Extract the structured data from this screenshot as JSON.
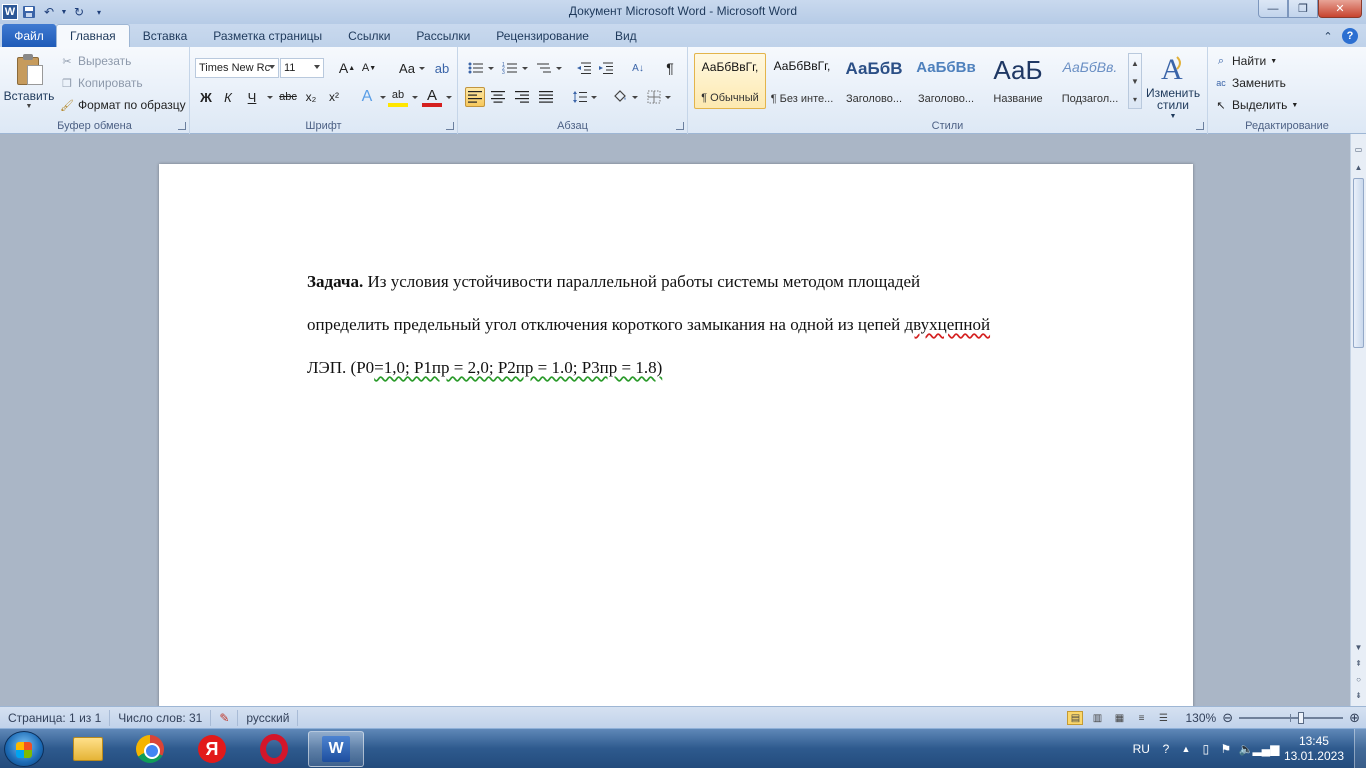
{
  "window": {
    "title": "Документ Microsoft Word  -  Microsoft Word",
    "minimize": "—",
    "maximize": "❐",
    "close": "✕"
  },
  "tabs": {
    "file": "Файл",
    "items": [
      "Главная",
      "Вставка",
      "Разметка страницы",
      "Ссылки",
      "Рассылки",
      "Рецензирование",
      "Вид"
    ]
  },
  "clipboard": {
    "paste": "Вставить",
    "cut": "Вырезать",
    "copy": "Копировать",
    "format_painter": "Формат по образцу",
    "label": "Буфер обмена"
  },
  "font": {
    "name": "Times New Rc",
    "size": "11",
    "label": "Шрифт",
    "grow": "A",
    "shrink": "A",
    "case": "Aa",
    "bold": "Ж",
    "italic": "К",
    "underline": "Ч",
    "strike": "abc",
    "subscript": "x₂",
    "superscript": "x²",
    "effects": "A",
    "highlight": "ab",
    "color": "A"
  },
  "paragraph": {
    "label": "Абзац",
    "show_marks": "¶"
  },
  "styles": {
    "label": "Стили",
    "items": [
      {
        "sample": "АаБбВвГг,",
        "name": "¶ Обычный"
      },
      {
        "sample": "АаБбВвГг,",
        "name": "¶ Без инте..."
      },
      {
        "sample": "АаБбВ",
        "name": "Заголово..."
      },
      {
        "sample": "АаБбВв",
        "name": "Заголово..."
      },
      {
        "sample": "АаБ",
        "name": "Название"
      },
      {
        "sample": "АаБбВв.",
        "name": "Подзагол..."
      }
    ],
    "change_line1": "Изменить",
    "change_line2": "стили"
  },
  "editing": {
    "label": "Редактирование",
    "find": "Найти",
    "replace": "Заменить",
    "select": "Выделить"
  },
  "document": {
    "bold_lead": "Задача.",
    "line1": " Из условия устойчивости параллельной работы системы методом площадей",
    "line2_start": "определить предельный угол отключения короткого замыкания на одной из цепей ",
    "line2_misspelled": "двухцепной",
    "line3_a": "ЛЭП. (Р0",
    "line3_b": "=1,0; Р1пр = 2,0; Р2пр = 1.0; Р3пр = 1.8)"
  },
  "status": {
    "page": "Страница: 1 из 1",
    "words": "Число слов: 31",
    "language": "русский",
    "zoom": "130%",
    "zoom_fraction": 0.6
  },
  "taskbar": {
    "lang": "RU",
    "time": "13:45",
    "date": "13.01.2023"
  }
}
